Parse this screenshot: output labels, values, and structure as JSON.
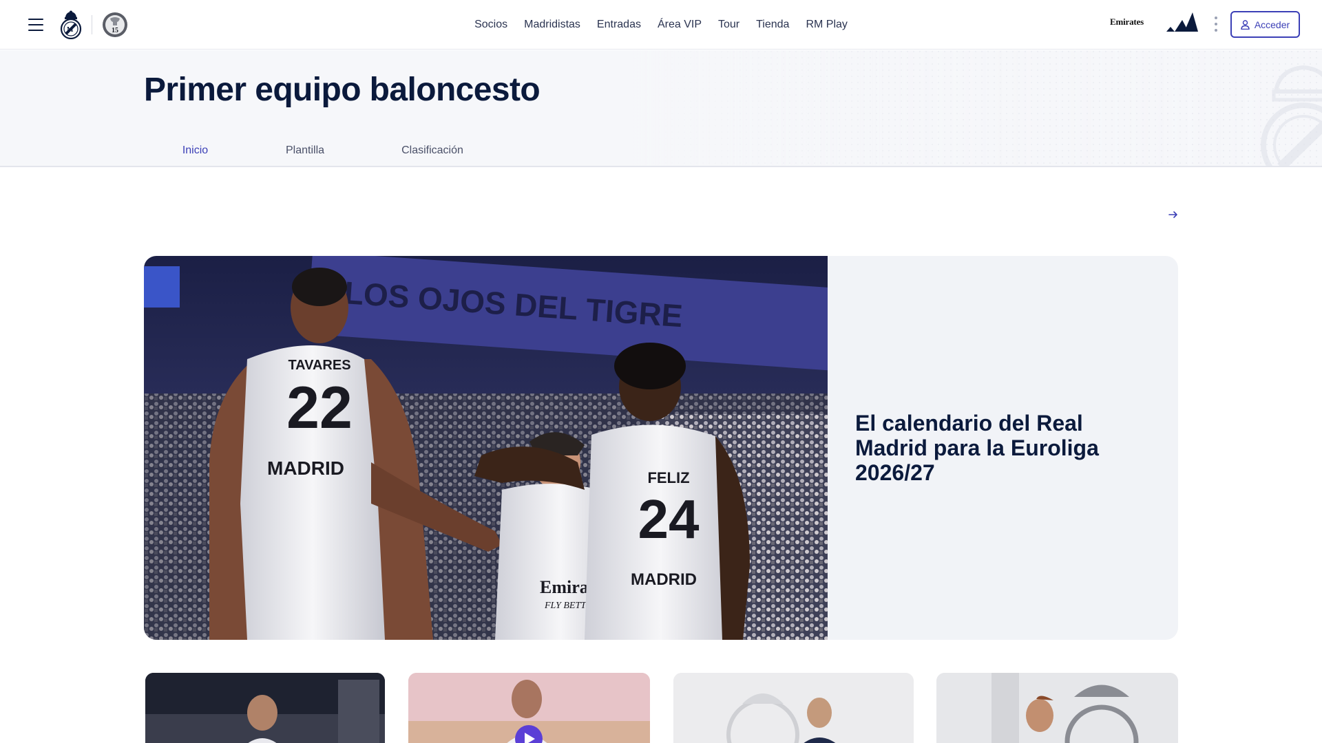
{
  "header": {
    "nav": [
      "Socios",
      "Madridistas",
      "Entradas",
      "Área VIP",
      "Tour",
      "Tienda",
      "RM Play"
    ],
    "sponsor_text": "Emirates",
    "login_label": "Acceder",
    "badge_number": "15"
  },
  "page": {
    "title": "Primer equipo baloncesto",
    "tabs": [
      "Inicio",
      "Plantilla",
      "Clasificación"
    ],
    "active_tab": "Inicio"
  },
  "featured": {
    "title": "El calendario del Real Madrid para la Euroliga 2026/27",
    "banner_text": "LOS OJOS DEL TIGRE",
    "players": [
      {
        "name": "TAVARES",
        "number": "22",
        "front": "MADRID"
      },
      {
        "name": "FELIZ",
        "number": "24",
        "front": "MADRID"
      }
    ],
    "shirt_sponsor": "Emirates",
    "shirt_sponsor_sub": "FLY BETTER"
  },
  "icons": {
    "menu": "hamburger-icon",
    "more": "kebab-icon",
    "user": "user-icon",
    "arrow": "arrow-right-icon",
    "play": "play-icon"
  },
  "colors": {
    "brand_navy": "#0b1a3c",
    "accent_purple": "#3b3fb6",
    "band_background": "#f6f7fa"
  }
}
